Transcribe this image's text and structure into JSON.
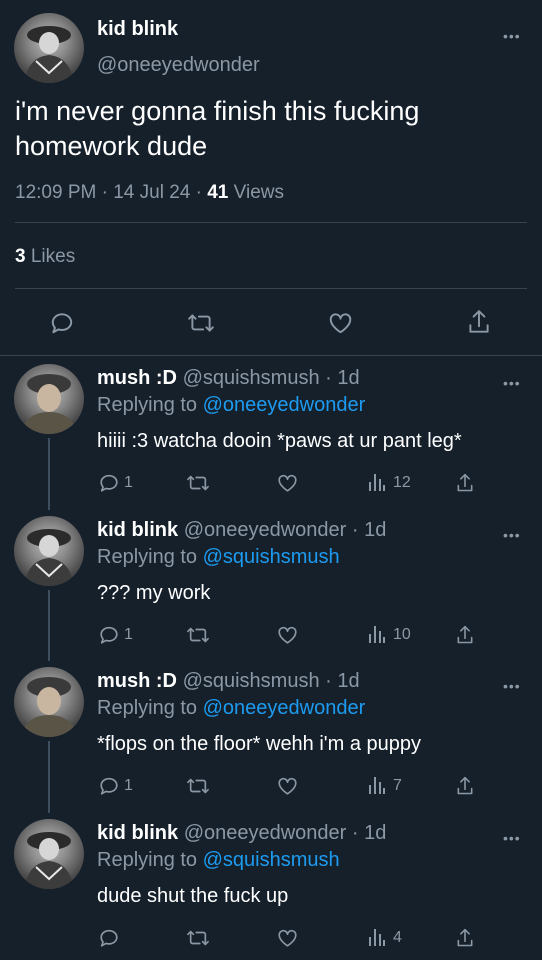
{
  "main_tweet": {
    "name": "kid blink",
    "handle": "@oneeyedwonder",
    "text": "i'm never gonna finish this fucking homework dude",
    "time": "12:09 PM",
    "date": "14 Jul 24",
    "views_count": "41",
    "views_label": "Views",
    "likes_count": "3",
    "likes_label": "Likes",
    "more_icon": "more-icon",
    "actions": [
      "reply-icon",
      "retweet-icon",
      "like-icon",
      "share-icon"
    ]
  },
  "replies": [
    {
      "name": "mush :D",
      "handle": "@squishsmush",
      "age": "1d",
      "replying_prefix": "Replying to",
      "replying_to": "@oneeyedwonder",
      "text": "hiiii :3 watcha dooin *paws at ur pant leg*",
      "reply_count": "1",
      "view_count": "12"
    },
    {
      "name": "kid blink",
      "handle": "@oneeyedwonder",
      "age": "1d",
      "replying_prefix": "Replying to",
      "replying_to": "@squishsmush",
      "text": "??? my work",
      "reply_count": "1",
      "view_count": "10"
    },
    {
      "name": "mush :D",
      "handle": "@squishsmush",
      "age": "1d",
      "replying_prefix": "Replying to",
      "replying_to": "@oneeyedwonder",
      "text": "*flops on the floor* wehh i'm a puppy",
      "reply_count": "1",
      "view_count": "7"
    },
    {
      "name": "kid blink",
      "handle": "@oneeyedwonder",
      "age": "1d",
      "replying_prefix": "Replying to",
      "replying_to": "@squishsmush",
      "text": "dude shut the fuck up",
      "reply_count": "",
      "view_count": "4"
    }
  ],
  "colors": {
    "background": "#15202b",
    "text": "#ffffff",
    "secondary": "#8b98a5",
    "link": "#1d9bf0",
    "divider": "#38444d"
  }
}
